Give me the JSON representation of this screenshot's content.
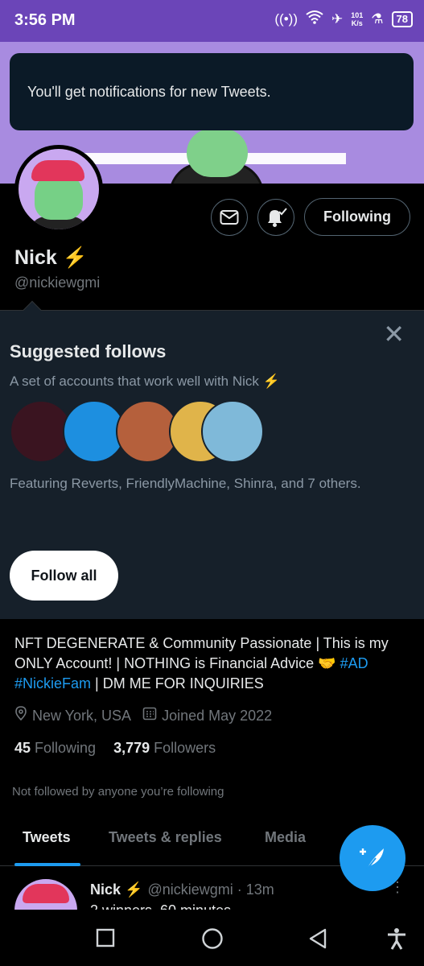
{
  "status_bar": {
    "time": "3:56 PM",
    "speed_value": "101",
    "speed_unit": "K/s",
    "battery": "78"
  },
  "toast": {
    "message": "You'll get notifications for new Tweets."
  },
  "profile": {
    "name": "Nick ⚡",
    "handle": "@nickiewgmi",
    "following_button": "Following"
  },
  "suggested": {
    "title": "Suggested follows",
    "subtitle": "A set of accounts that work well with Nick ⚡",
    "featuring": "Featuring Reverts, FriendlyMachine, Shinra, and 7 others.",
    "follow_all": "Follow all",
    "avatar_colors": [
      "#3a1420",
      "#1d8fe0",
      "#b5603c",
      "#e0b44a",
      "#7fb9d9"
    ]
  },
  "bio": {
    "text_1": "NFT DEGENERATE & Community Passionate | This is my ONLY Account! | NOTHING is Financial Advice 🤝 ",
    "hashtag_1": "#AD",
    "hashtag_2": "#NickieFam",
    "text_2": " | DM ME FOR INQUIRIES"
  },
  "meta": {
    "location": "New York, USA",
    "joined": "Joined May 2022"
  },
  "counts": {
    "following_count": "45",
    "following_label": "Following",
    "followers_count": "3,779",
    "followers_label": "Followers"
  },
  "not_followed": "Not followed by anyone you’re following",
  "tabs": [
    "Tweets",
    "Tweets & replies",
    "Media"
  ],
  "tweet": {
    "name": "Nick ⚡",
    "handle_time": "@nickiewgmi · 13m",
    "text": "2 winners, 60 minutes"
  },
  "colors": {
    "accent": "#1d9bf0",
    "status_bar": "#6b45b8",
    "banner": "#a88be0"
  }
}
